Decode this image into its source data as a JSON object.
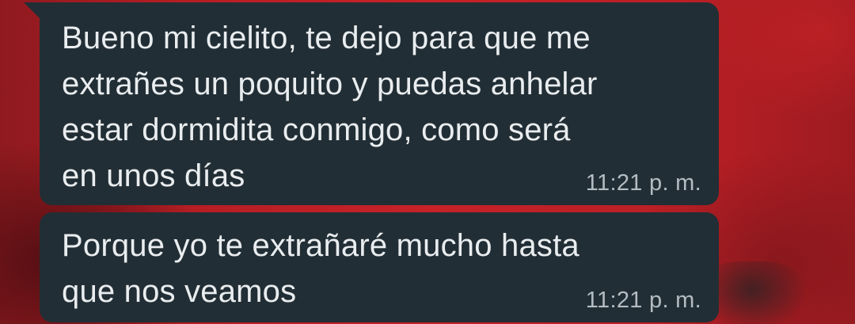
{
  "wallpaper": {
    "color": "#c62228"
  },
  "messages": [
    {
      "text": "Bueno mi cielito, te dejo para que me\nextrañes un poquito y puedas anhelar\nestar dormidita conmigo, como será\nen unos días",
      "time": "11:21 p. m."
    },
    {
      "text": "Porque yo te extrañaré mucho hasta\nque nos veamos",
      "time": "11:21 p. m."
    }
  ],
  "colors": {
    "bubble_bg": "#222e35",
    "text": "#e9edef",
    "timestamp": "#b3bcc2"
  }
}
